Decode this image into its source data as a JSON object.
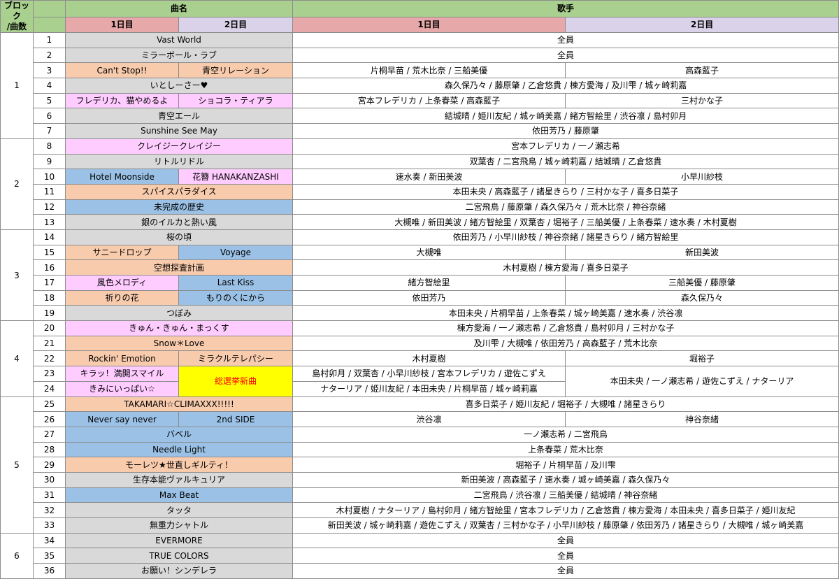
{
  "header": {
    "block": "ブロック\n/曲数",
    "song": "曲名",
    "singer": "歌手",
    "day1": "1日目",
    "day2": "2日目"
  },
  "colors": {
    "header_green": "#a9d08e",
    "day1_header": "#e6a8a8",
    "day2_header": "#d9d2e9",
    "gray": "#d9d9d9",
    "orange": "#f8cbad",
    "pink": "#ffccff",
    "blue": "#9bc2e6",
    "yellow": "#ffff00",
    "red_text": "#ff0000"
  },
  "blocks": [
    "1",
    "2",
    "3",
    "4",
    "5",
    "6"
  ],
  "rows": [
    {
      "n": "1",
      "s": "Vast World",
      "c": "gray",
      "singer": "全員"
    },
    {
      "n": "2",
      "s": "ミラーボール・ラブ",
      "c": "gray",
      "singer": "全員"
    },
    {
      "n": "3",
      "s1": "Can't Stop!!",
      "c1": "orange",
      "s2": "青空リレーション",
      "c2": "orange",
      "g1": "片桐早苗 / 荒木比奈 / 三船美優",
      "g2": "高森藍子"
    },
    {
      "n": "4",
      "s": "いとしーさー♥",
      "c": "gray",
      "singer": "森久保乃々 / 藤原肇 / 乙倉悠貴 / 棟方愛海 / 及川雫 / 城ヶ崎莉嘉"
    },
    {
      "n": "5",
      "s1": "フレデリカ、猫やめるよ",
      "c1": "pink",
      "s2": "ショコラ・ティアラ",
      "c2": "pink",
      "g1": "宮本フレデリカ / 上条春菜 / 高森藍子",
      "g2": "三村かな子"
    },
    {
      "n": "6",
      "s": "青空エール",
      "c": "gray",
      "singer": "結城晴 / 姫川友紀 / 城ヶ崎美嘉 / 緒方智絵里 / 渋谷凛 / 島村卯月"
    },
    {
      "n": "7",
      "s": "Sunshine See May",
      "c": "gray",
      "singer": "依田芳乃 / 藤原肇"
    },
    {
      "n": "8",
      "s": "クレイジークレイジー",
      "c": "pink",
      "singer": "宮本フレデリカ / 一ノ瀬志希"
    },
    {
      "n": "9",
      "s": "リトルリドル",
      "c": "gray",
      "singer": "双葉杏 / 二宮飛鳥 / 城ヶ崎莉嘉 / 結城晴 / 乙倉悠貴"
    },
    {
      "n": "10",
      "s1": "Hotel Moonside",
      "c1": "blue",
      "s2": "花簪 HANAKANZASHI",
      "c2": "pink",
      "g1": "速水奏 / 新田美波",
      "g2": "小早川紗枝"
    },
    {
      "n": "11",
      "s": "スパイスパラダイス",
      "c": "orange",
      "singer": "本田未央 / 高森藍子 / 諸星きらり / 三村かな子 / 喜多日菜子"
    },
    {
      "n": "12",
      "s": "未完成の歴史",
      "c": "blue",
      "singer": "二宮飛鳥 / 藤原肇 / 森久保乃々 / 荒木比奈 / 神谷奈緒"
    },
    {
      "n": "13",
      "s": "銀のイルカと熱い風",
      "c": "gray",
      "singer": "大槻唯 / 新田美波 / 緒方智絵里 / 双葉杏 / 堀裕子 / 三船美優 / 上条春菜 / 速水奏 / 木村夏樹"
    },
    {
      "n": "14",
      "s": "桜の頃",
      "c": "gray",
      "singer": "依田芳乃 / 小早川紗枝 / 神谷奈緒 / 諸星きらり / 緒方智絵里"
    },
    {
      "n": "15",
      "s1": "サニードロップ",
      "c1": "orange",
      "s2": "Voyage",
      "c2": "blue",
      "g1": "大槻唯",
      "g2": "新田美波"
    },
    {
      "n": "16",
      "s": "空想探査計画",
      "c": "orange",
      "singer": "木村夏樹 / 棟方愛海 / 喜多日菜子"
    },
    {
      "n": "17",
      "s1": "風色メロディ",
      "c1": "pink",
      "s2": "Last Kiss",
      "c2": "blue",
      "g1": "緒方智絵里",
      "g2": "三船美優 / 藤原肇"
    },
    {
      "n": "18",
      "s1": "祈りの花",
      "c1": "orange",
      "s2": "もりのくにから",
      "c2": "blue",
      "g1": "依田芳乃",
      "g2": "森久保乃々"
    },
    {
      "n": "19",
      "s": "つぼみ",
      "c": "gray",
      "singer": "本田未央 / 片桐早苗 / 上条春菜 / 城ヶ崎美嘉 / 速水奏 / 渋谷凛"
    },
    {
      "n": "20",
      "s": "きゅん・きゅん・まっくす",
      "c": "pink",
      "singer": "棟方愛海 / 一ノ瀬志希 / 乙倉悠貴 / 島村卯月 / 三村かな子"
    },
    {
      "n": "21",
      "s": "Snow＊Love",
      "c": "orange",
      "singer": "及川雫 / 大槻唯 / 依田芳乃 / 高森藍子 / 荒木比奈"
    },
    {
      "n": "22",
      "s1": "Rockin' Emotion",
      "c1": "orange",
      "s2": "ミラクルテレパシー",
      "c2": "orange",
      "g1": "木村夏樹",
      "g2": "堀裕子"
    },
    {
      "n": "23",
      "s1": "キラッ！満開スマイル",
      "c1": "pink",
      "g1": "島村卯月 / 双葉杏 / 小早川紗枝 / 宮本フレデリカ / 遊佐こずえ"
    },
    {
      "n": "24",
      "s1": "きみにいっぱい☆",
      "c1": "pink",
      "g1": "ナターリア / 姫川友紀 / 本田未央 / 片桐早苗 / 城ヶ崎莉嘉"
    },
    {
      "n": "25",
      "s": "TAKAMARI☆CLIMAXXX!!!!!",
      "c": "orange",
      "singer": "喜多日菜子 / 姫川友紀 / 堀裕子 / 大槻唯 / 諸星きらり"
    },
    {
      "n": "26",
      "s1": "Never say never",
      "c1": "blue",
      "s2": "2nd SIDE",
      "c2": "blue",
      "g1": "渋谷凛",
      "g2": "神谷奈緒"
    },
    {
      "n": "27",
      "s": "バベル",
      "c": "blue",
      "singer": "一ノ瀬志希 / 二宮飛鳥"
    },
    {
      "n": "28",
      "s": "Needle Light",
      "c": "blue",
      "singer": "上条春菜 / 荒木比奈"
    },
    {
      "n": "29",
      "s": "モーレツ★世直しギルティ！",
      "c": "orange",
      "singer": "堀裕子 / 片桐早苗 / 及川雫"
    },
    {
      "n": "30",
      "s": "生存本能ヴァルキュリア",
      "c": "gray",
      "singer": "新田美波 / 高森藍子 / 速水奏 / 城ヶ崎美嘉 / 森久保乃々"
    },
    {
      "n": "31",
      "s": "Max Beat",
      "c": "blue",
      "singer": "二宮飛鳥 / 渋谷凛 / 三船美優 / 結城晴 / 神谷奈緒"
    },
    {
      "n": "32",
      "s": "タッタ",
      "c": "gray",
      "singer": "木村夏樹 / ナターリア / 島村卯月 / 緒方智絵里 / 宮本フレデリカ / 乙倉悠貴 / 棟方愛海 / 本田未央 / 喜多日菜子 / 姫川友紀"
    },
    {
      "n": "33",
      "s": "無重力シャトル",
      "c": "gray",
      "singer": "新田美波 / 城ヶ崎莉嘉 / 遊佐こずえ / 双葉杏 / 三村かな子 / 小早川紗枝 / 藤原肇 / 依田芳乃 / 諸星きらり / 大槻唯 / 城ヶ崎美嘉"
    },
    {
      "n": "34",
      "s": "EVERMORE",
      "c": "gray",
      "singer": "全員"
    },
    {
      "n": "35",
      "s": "TRUE COLORS",
      "c": "gray",
      "singer": "全員"
    },
    {
      "n": "36",
      "s": "お願い！シンデレラ",
      "c": "gray",
      "singer": "全員"
    }
  ],
  "merged": {
    "song_23_24_day2": "総選挙新曲",
    "singer_23_24_day2": "本田未央 / 一ノ瀬志希 / 遊佐こずえ / ナターリア"
  }
}
